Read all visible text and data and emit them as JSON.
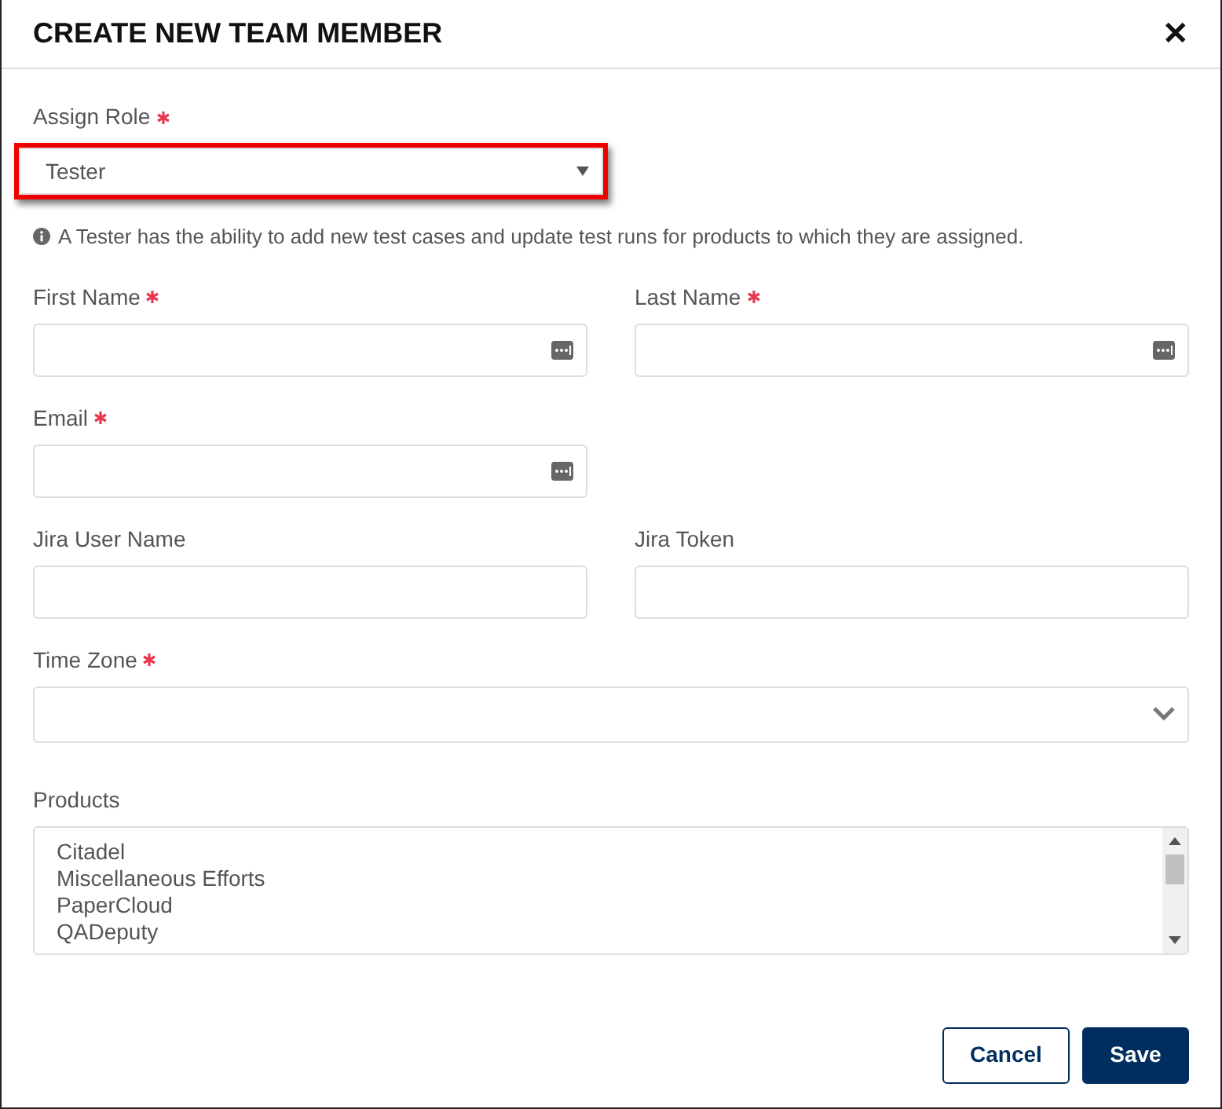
{
  "dialog": {
    "title": "CREATE NEW TEAM MEMBER",
    "close": "✕"
  },
  "role": {
    "label": "Assign Role",
    "required": true,
    "value": "Tester",
    "highlighted": true
  },
  "role_hint": "A Tester has the ability to add new test cases and update test runs for products to which they are assigned.",
  "fields": [
    {
      "label": "First Name",
      "required": true,
      "autofill": true
    },
    {
      "label": "Last Name",
      "required": true,
      "autofill": true
    },
    {
      "label": "Email",
      "required": true,
      "autofill": true
    },
    {
      "kind": "spacer"
    },
    {
      "label": "Jira User Name",
      "required": false,
      "autofill": false
    },
    {
      "label": "Jira Token",
      "required": false,
      "autofill": false
    }
  ],
  "time_zone": {
    "label": "Time Zone",
    "required": true
  },
  "products": {
    "label": "Products",
    "items": [
      "Citadel",
      "Miscellaneous Efforts",
      "PaperCloud",
      "QADeputy"
    ]
  },
  "buttons": [
    {
      "label": "Cancel",
      "kind": "secondary"
    },
    {
      "label": "Save",
      "kind": "primary"
    }
  ]
}
